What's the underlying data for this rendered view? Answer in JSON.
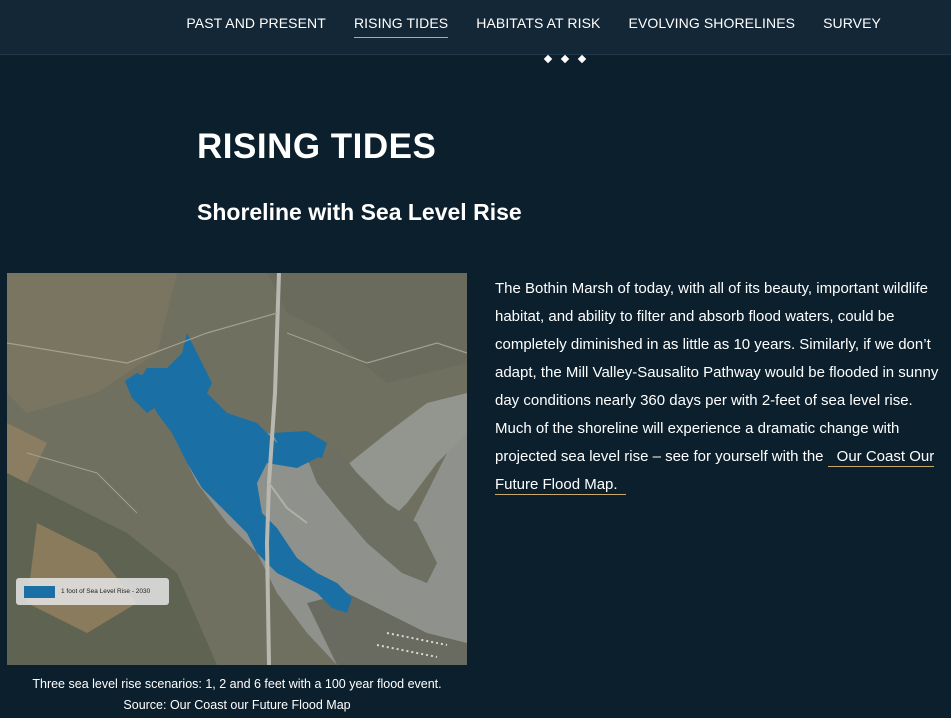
{
  "nav": {
    "items": [
      {
        "label": "PAST AND PRESENT",
        "active": false
      },
      {
        "label": "RISING TIDES",
        "active": true
      },
      {
        "label": "HABITATS AT RISK",
        "active": false
      },
      {
        "label": "EVOLVING SHORELINES",
        "active": false
      },
      {
        "label": "SURVEY",
        "active": false
      }
    ]
  },
  "page": {
    "title": "RISING TIDES",
    "section_title": "Shoreline with Sea Level Rise"
  },
  "map": {
    "legend_label": "1 foot of Sea Level Rise - 2030",
    "flood_color": "#1a6fa5",
    "caption_line1": "Three sea level rise scenarios: 1, 2 and 6 feet with a 100 year flood event.",
    "caption_line2": "Source: Our Coast our Future Flood Map"
  },
  "body": {
    "paragraph": "The Bothin Marsh of today, with all of its beauty, important wildlife habitat, and ability to filter and absorb flood waters, could be completely diminished in as little as 10 years. Similarly, if we don’t adapt, the Mill Valley-Sausalito Pathway would be flooded in sunny day conditions  nearly 360 days per with 2-feet of sea level rise. Much of the shoreline will experience a dramatic change with projected sea level rise – see for yourself with the ",
    "link_text": "Our Coast Our Future  Flood Map."
  },
  "colors": {
    "background": "#0c1f2d",
    "nav_background": "#142737",
    "accent_underline": "#c9a86a"
  }
}
